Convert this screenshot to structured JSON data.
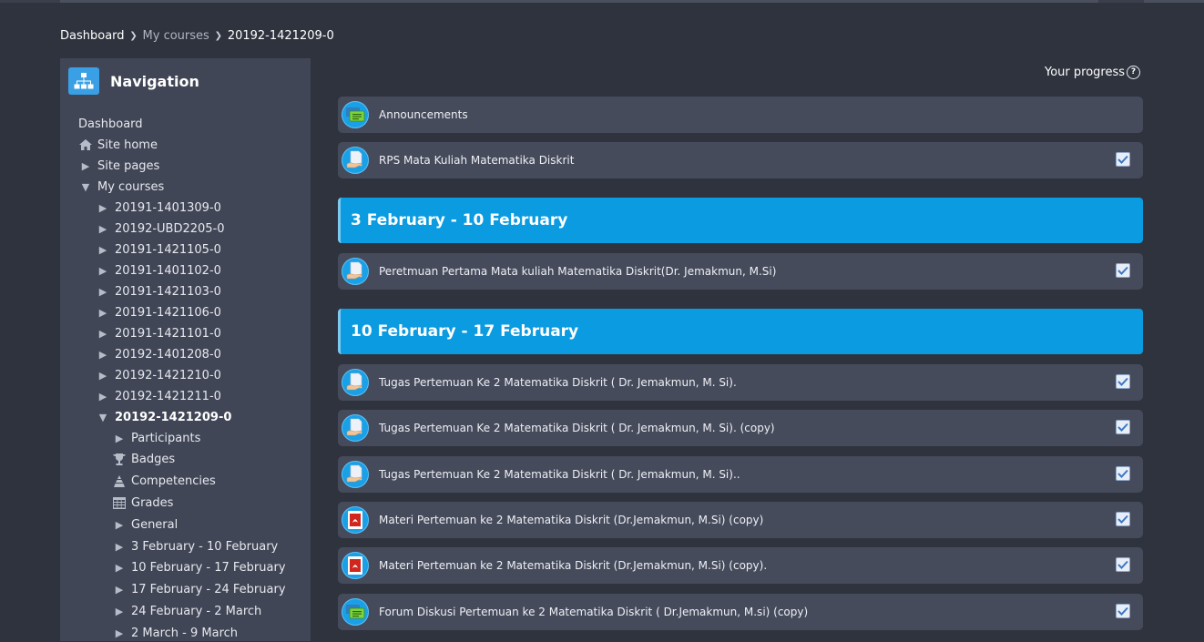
{
  "breadcrumb": {
    "items": [
      {
        "label": "Dashboard",
        "muted": false
      },
      {
        "label": "My courses",
        "muted": true
      },
      {
        "label": "20192-1421209-0",
        "muted": false
      }
    ]
  },
  "nav": {
    "title": "Navigation",
    "items": [
      {
        "label": "Dashboard",
        "icon": "none",
        "level": 0,
        "bold": false
      },
      {
        "label": "Site home",
        "icon": "home-icon",
        "level": 0,
        "bold": false
      },
      {
        "label": "Site pages",
        "icon": "caret-right-icon",
        "level": 0,
        "bold": false
      },
      {
        "label": "My courses",
        "icon": "caret-down-icon",
        "level": 0,
        "bold": false
      },
      {
        "label": "20191-1401309-0",
        "icon": "caret-right-icon",
        "level": 1,
        "bold": false
      },
      {
        "label": "20192-UBD2205-0",
        "icon": "caret-right-icon",
        "level": 1,
        "bold": false
      },
      {
        "label": "20191-1421105-0",
        "icon": "caret-right-icon",
        "level": 1,
        "bold": false
      },
      {
        "label": "20191-1401102-0",
        "icon": "caret-right-icon",
        "level": 1,
        "bold": false
      },
      {
        "label": "20191-1421103-0",
        "icon": "caret-right-icon",
        "level": 1,
        "bold": false
      },
      {
        "label": "20191-1421106-0",
        "icon": "caret-right-icon",
        "level": 1,
        "bold": false
      },
      {
        "label": "20191-1421101-0",
        "icon": "caret-right-icon",
        "level": 1,
        "bold": false
      },
      {
        "label": "20192-1401208-0",
        "icon": "caret-right-icon",
        "level": 1,
        "bold": false
      },
      {
        "label": "20192-1421210-0",
        "icon": "caret-right-icon",
        "level": 1,
        "bold": false
      },
      {
        "label": "20192-1421211-0",
        "icon": "caret-right-icon",
        "level": 1,
        "bold": false
      },
      {
        "label": "20192-1421209-0",
        "icon": "caret-down-icon",
        "level": 1,
        "bold": true
      },
      {
        "label": "Participants",
        "icon": "caret-right-icon",
        "level": 2,
        "bold": false
      },
      {
        "label": "Badges",
        "icon": "trophy-icon",
        "level": 2,
        "bold": false
      },
      {
        "label": "Competencies",
        "icon": "competencies-icon",
        "level": 2,
        "bold": false
      },
      {
        "label": "Grades",
        "icon": "grades-table-icon",
        "level": 2,
        "bold": false
      },
      {
        "label": "General",
        "icon": "caret-right-icon",
        "level": 2,
        "bold": false
      },
      {
        "label": "3 February - 10 February",
        "icon": "caret-right-icon",
        "level": 2,
        "bold": false
      },
      {
        "label": "10 February - 17 February",
        "icon": "caret-right-icon",
        "level": 2,
        "bold": false
      },
      {
        "label": "17 February - 24 February",
        "icon": "caret-right-icon",
        "level": 2,
        "bold": false
      },
      {
        "label": "24 February - 2 March",
        "icon": "caret-right-icon",
        "level": 2,
        "bold": false
      },
      {
        "label": "2 March - 9 March",
        "icon": "caret-right-icon",
        "level": 2,
        "bold": false
      }
    ]
  },
  "progress": {
    "label": "Your progress",
    "help_icon": "question-circle-icon"
  },
  "content": {
    "general": [
      {
        "label": "Announcements",
        "icon": "forum-icon",
        "checked": null
      },
      {
        "label": "RPS Mata Kuliah Matematika Diskrit",
        "icon": "assignment-icon",
        "checked": true
      }
    ],
    "sections": [
      {
        "title": "3 February - 10 February",
        "activities": [
          {
            "label": "Peretmuan Pertama Mata kuliah Matematika Diskrit(Dr. Jemakmun, M.Si)",
            "icon": "assignment-icon",
            "checked": true
          }
        ]
      },
      {
        "title": "10 February - 17 February",
        "activities": [
          {
            "label": "Tugas Pertemuan Ke 2 Matematika Diskrit ( Dr. Jemakmun, M. Si).",
            "icon": "assignment-icon",
            "checked": true
          },
          {
            "label": "Tugas Pertemuan Ke 2 Matematika Diskrit ( Dr. Jemakmun, M. Si). (copy)",
            "icon": "assignment-icon",
            "checked": true
          },
          {
            "label": "Tugas Pertemuan Ke 2 Matematika Diskrit ( Dr. Jemakmun, M. Si)..",
            "icon": "assignment-icon",
            "checked": true
          },
          {
            "label": "Materi Pertemuan ke 2 Matematika Diskrit (Dr.Jemakmun, M.Si) (copy)",
            "icon": "pdf-icon",
            "checked": true
          },
          {
            "label": "Materi Pertemuan ke 2 Matematika Diskrit (Dr.Jemakmun, M.Si) (copy).",
            "icon": "pdf-icon",
            "checked": true
          },
          {
            "label": "Forum Diskusi Pertemuan ke 2 Matematika Diskrit ( Dr.Jemakmun, M.si) (copy)",
            "icon": "forum-icon",
            "checked": true
          }
        ]
      }
    ]
  },
  "colors": {
    "page_bg": "#2f333e",
    "nav_bg": "#414656",
    "activity_bg": "#464b5c",
    "section_bg": "#0b9be0",
    "accent": "#39a0e6"
  }
}
